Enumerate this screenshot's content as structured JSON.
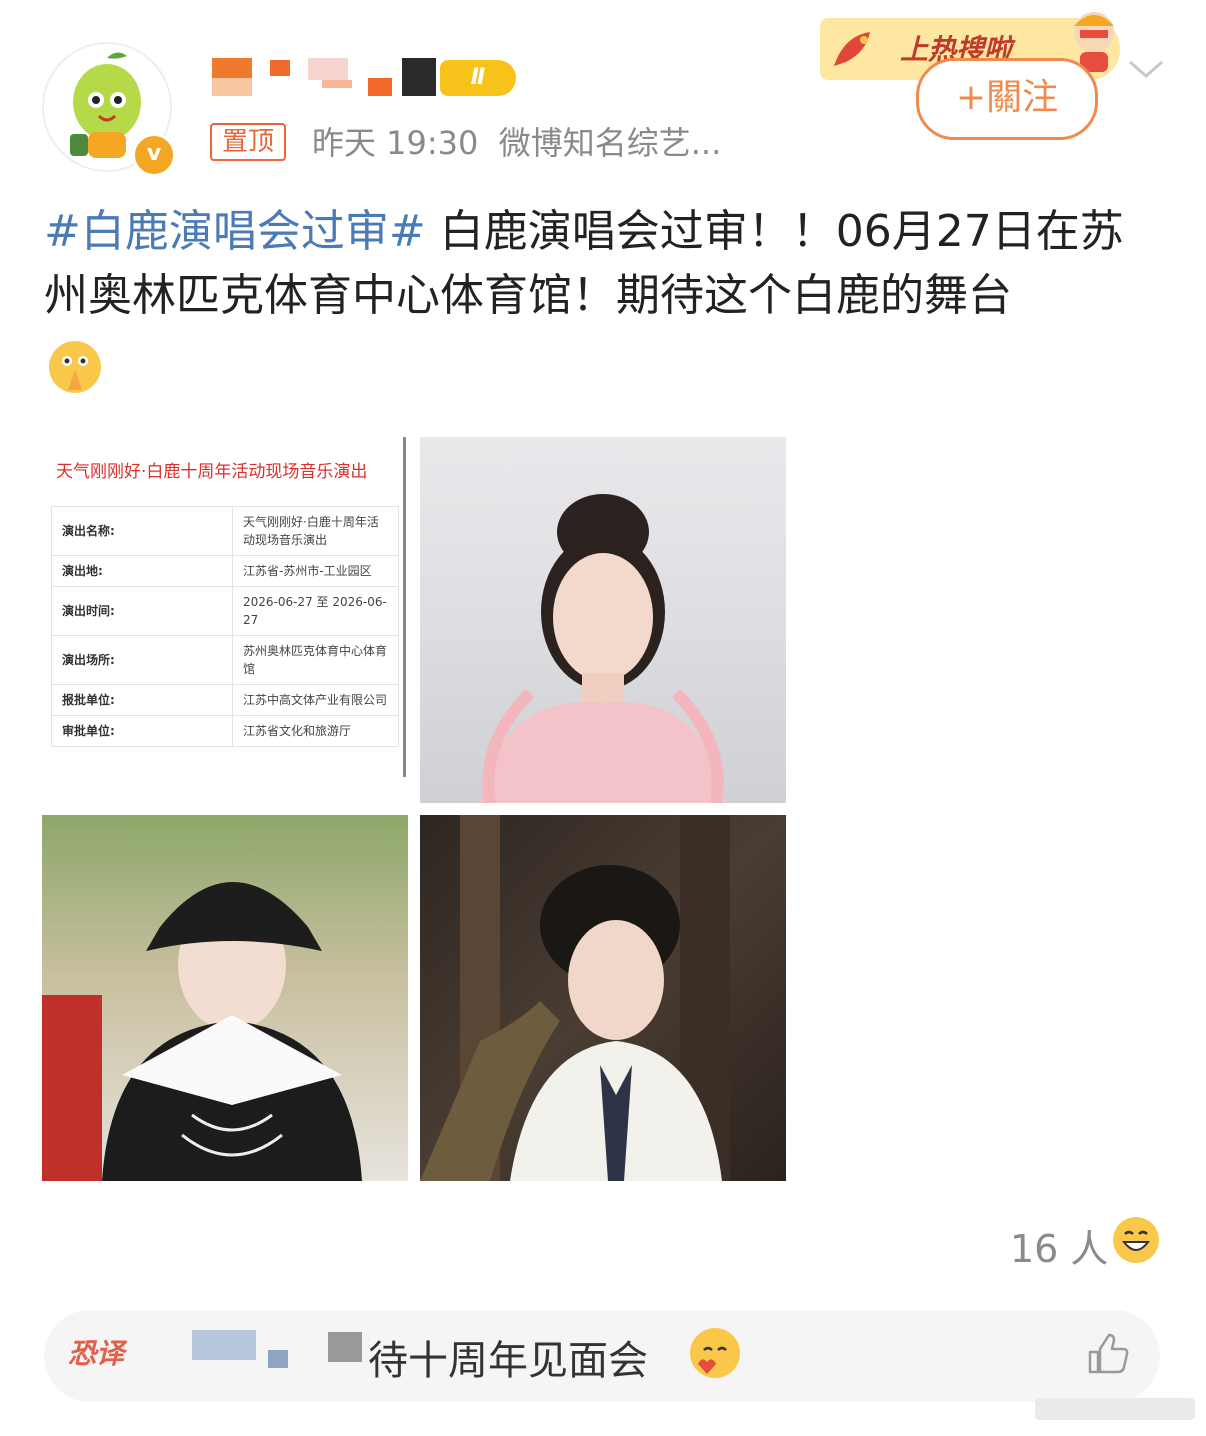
{
  "header": {
    "pin_label": "置顶",
    "timestamp": "昨天 19:30",
    "source": "微博知名综艺...",
    "verified_badge": "v",
    "level_badge": "Ⅱ"
  },
  "hot_banner": {
    "text": "上热搜啦"
  },
  "follow_button": {
    "label": "+關注"
  },
  "post": {
    "hashtag": "#白鹿演唱会过审#",
    "body": " 白鹿演唱会过审！！06月27日在苏州奥林匹克体育中心体育馆！期待这个白鹿的舞台"
  },
  "document_image": {
    "title": "天气刚刚好·白鹿十周年活动现场音乐演出",
    "rows": [
      {
        "key": "演出名称:",
        "value": "天气刚刚好·白鹿十周年活动现场音乐演出"
      },
      {
        "key": "演出地:",
        "value": "江苏省-苏州市-工业园区"
      },
      {
        "key": "演出时间:",
        "value": "2026-06-27 至 2026-06-27"
      },
      {
        "key": "演出场所:",
        "value": "苏州奥林匹克体育中心体育馆"
      },
      {
        "key": "报批单位:",
        "value": "江苏中高文体产业有限公司"
      },
      {
        "key": "审批单位:",
        "value": "江苏省文化和旅游厅"
      }
    ]
  },
  "reactions": {
    "count": "16 人"
  },
  "comment": {
    "author_tag": "恐译",
    "text": "待十周年见面会"
  },
  "colors": {
    "hashtag": "#4a7bb7",
    "accent_orange": "#ee8c4e",
    "badge_yellow": "#f5a623",
    "text_gray": "#8a8a8a"
  },
  "icons": [
    "avatar-mascot",
    "verified-badge-icon",
    "hot-banner-icon",
    "chevron-down-icon",
    "pray-emoji-icon",
    "laugh-emoji-icon",
    "love-emoji-icon",
    "thumbs-up-icon"
  ]
}
